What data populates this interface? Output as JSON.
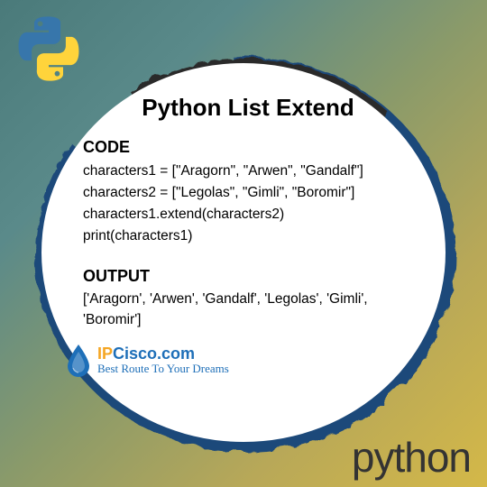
{
  "logo_alt": "python-logo",
  "title": "Python List Extend",
  "code_heading": "CODE",
  "code_lines": "characters1 = [\"Aragorn\", \"Arwen\", \"Gandalf\"]\ncharacters2 = [\"Legolas\", \"Gimli\", \"Boromir\"]\ncharacters1.extend(characters2)\nprint(characters1)",
  "output_heading": "OUTPUT",
  "output_text": "['Aragorn', 'Arwen', 'Gandalf', 'Legolas', 'Gimli', 'Boromir']",
  "brand_ip": "IP",
  "brand_cisco": "Cisco",
  "brand_suffix": ".com",
  "tagline": "Best Route To Your Dreams",
  "footer_word": "python",
  "colors": {
    "blue": "#3776ab",
    "yellow": "#ffd43b"
  }
}
